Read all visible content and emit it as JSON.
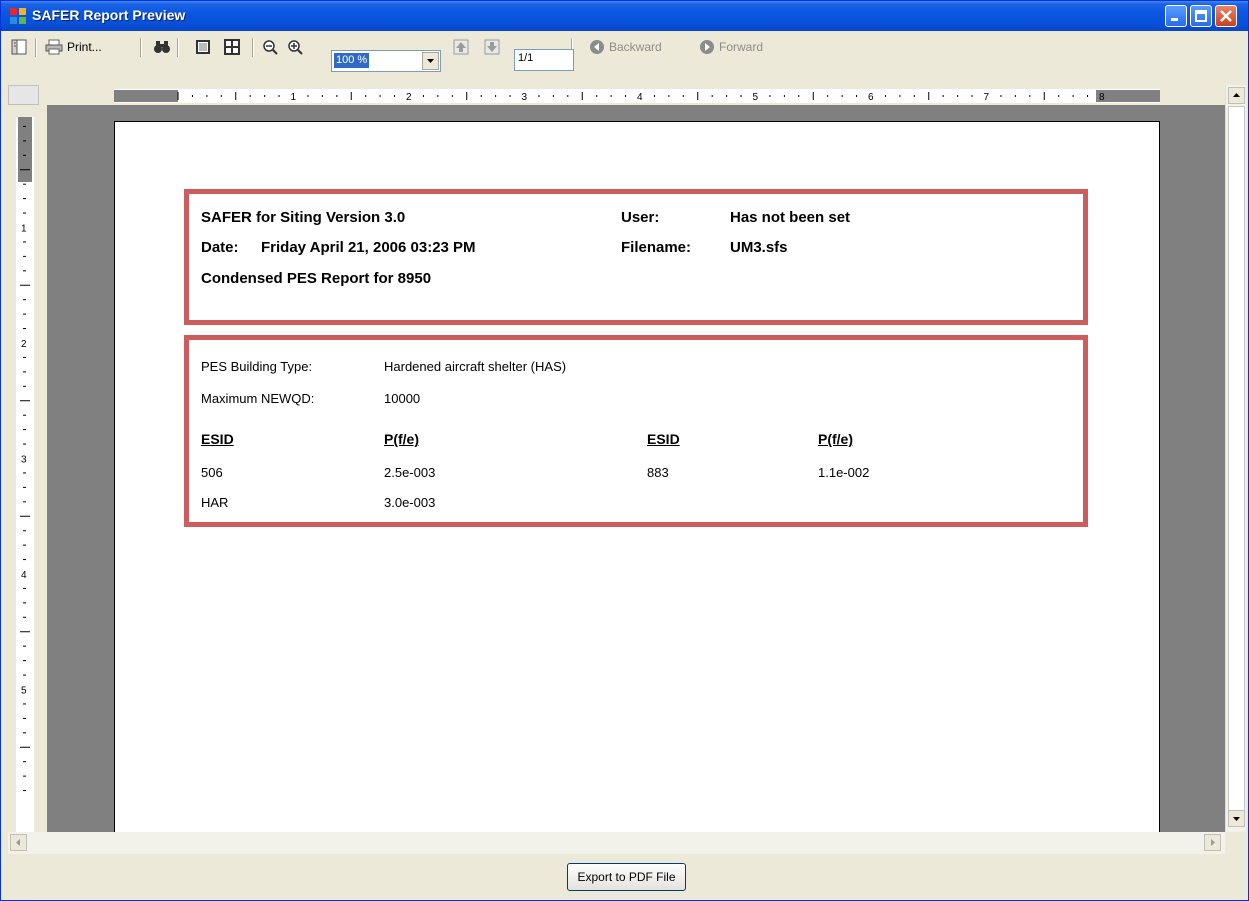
{
  "window": {
    "title": "SAFER Report Preview"
  },
  "toolbar": {
    "print_label": "Print...",
    "zoom_value": "100 %",
    "page_value": "1/1",
    "backward_label": "Backward",
    "forward_label": "Forward"
  },
  "rulers": {
    "horizontal_labels": [
      "1",
      "2",
      "3",
      "4",
      "5",
      "6",
      "7",
      "8"
    ],
    "vertical_labels": [
      "1",
      "2",
      "3",
      "4",
      "5"
    ]
  },
  "report": {
    "header": {
      "app_version": "SAFER for Siting Version 3.0",
      "date_label": "Date:",
      "date_value": "Friday April 21, 2006  03:23 PM",
      "report_title": "Condensed PES Report for 8950",
      "user_label": "User:",
      "user_value": "Has not been set",
      "filename_label": "Filename:",
      "filename_value": "UM3.sfs"
    },
    "details": {
      "building_type_label": "PES Building Type:",
      "building_type_value": "Hardened aircraft shelter (HAS)",
      "max_newqd_label": "Maximum NEWQD:",
      "max_newqd_value": "10000",
      "columns": [
        "ESID",
        "P(f/e)",
        "ESID",
        "P(f/e)"
      ],
      "rows": [
        [
          "506",
          "2.5e-003",
          "883",
          "1.1e-002"
        ],
        [
          "HAR",
          "3.0e-003",
          "",
          ""
        ]
      ]
    }
  },
  "footer": {
    "export_label": "Export to PDF File"
  }
}
